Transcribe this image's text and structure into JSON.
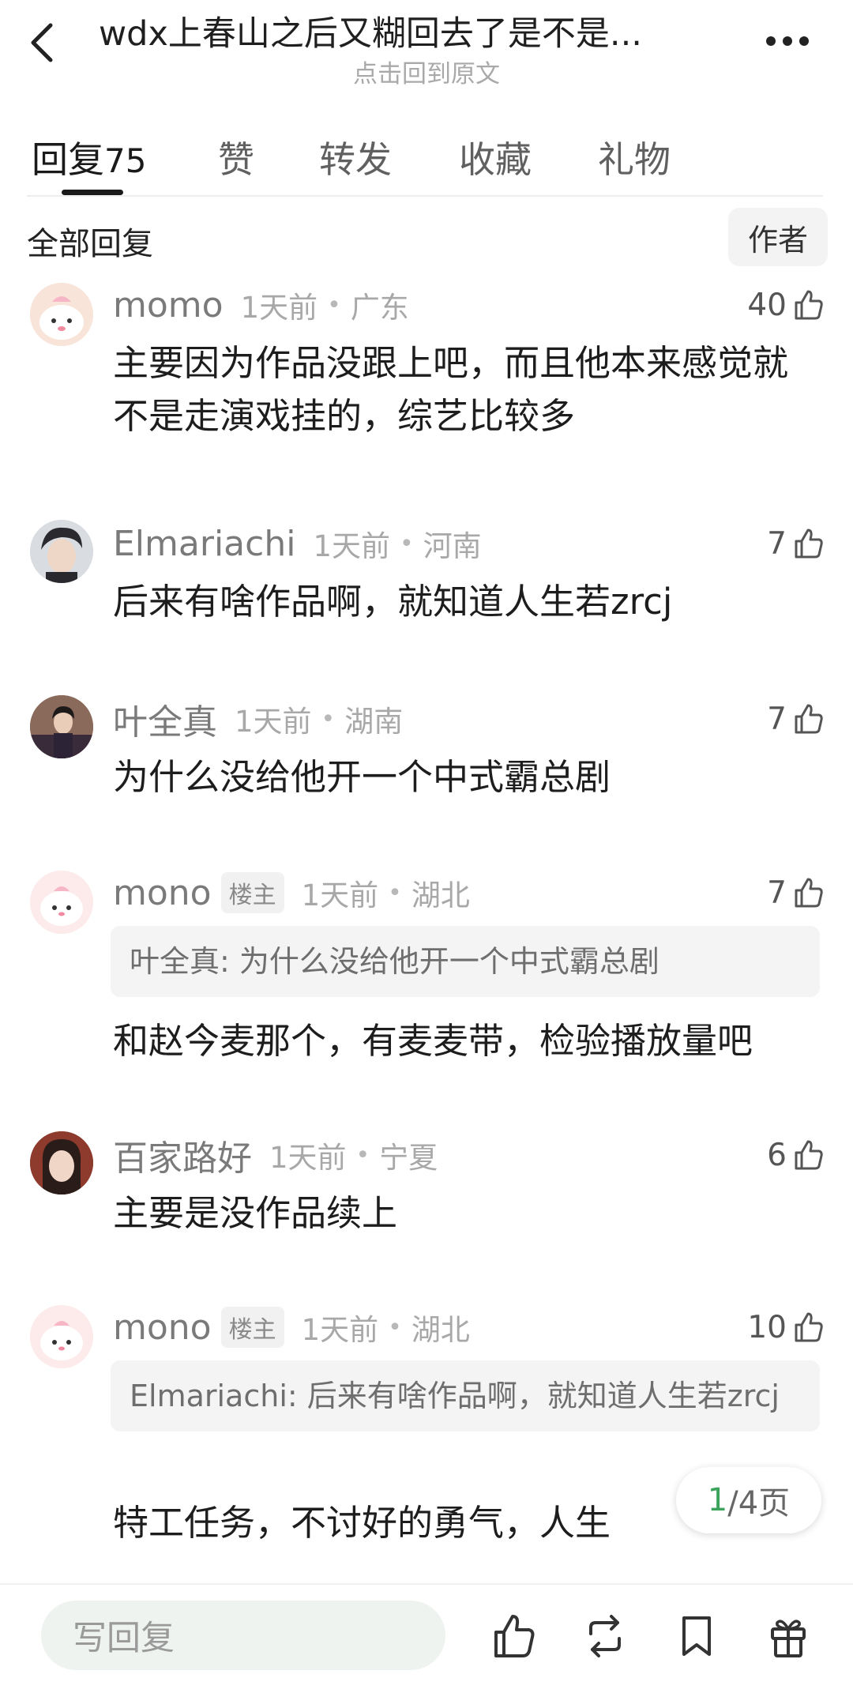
{
  "header": {
    "title": "wdx上春山之后又糊回去了是不是...",
    "subtitle": "点击回到原文"
  },
  "tabs": [
    {
      "label": "回复",
      "count": "75"
    },
    {
      "label": "赞"
    },
    {
      "label": "转发"
    },
    {
      "label": "收藏"
    },
    {
      "label": "礼物"
    }
  ],
  "filter": {
    "section_title": "全部回复",
    "author_button": "作者"
  },
  "comments": [
    {
      "user": "momo",
      "time": "1天前",
      "region": "广东",
      "likes": "40",
      "text": "主要因为作品没跟上吧，而且他本来感觉就不是走演戏挂的，综艺比较多"
    },
    {
      "user": "Elmariachi",
      "time": "1天前",
      "region": "河南",
      "likes": "7",
      "text": "后来有啥作品啊，就知道人生若zrcj"
    },
    {
      "user": "叶全真",
      "time": "1天前",
      "region": "湖南",
      "likes": "7",
      "text": "为什么没给他开一个中式霸总剧"
    },
    {
      "user": "mono",
      "badge": "楼主",
      "time": "1天前",
      "region": "湖北",
      "likes": "7",
      "quote": "叶全真: 为什么没给他开一个中式霸总剧",
      "text": "和赵今麦那个，有麦麦带，检验播放量吧"
    },
    {
      "user": "百家路好",
      "time": "1天前",
      "region": "宁夏",
      "likes": "6",
      "text": "主要是没作品续上"
    },
    {
      "user": "mono",
      "badge": "楼主",
      "time": "1天前",
      "region": "湖北",
      "likes": "10",
      "quote": "Elmariachi: 后来有啥作品啊，就知道人生若zrcj",
      "text": "特工任务，不讨好的勇气，人生"
    }
  ],
  "dot": "•",
  "pager": {
    "current": "1",
    "total": "/4页"
  },
  "bottom_bar": {
    "reply_placeholder": "写回复",
    "icons": [
      "thumb-up-icon",
      "repost-icon",
      "bookmark-icon",
      "gift-icon"
    ]
  },
  "colors": {
    "accent_green": "#3ba35b",
    "reply_box_bg": "#eef3ef"
  }
}
